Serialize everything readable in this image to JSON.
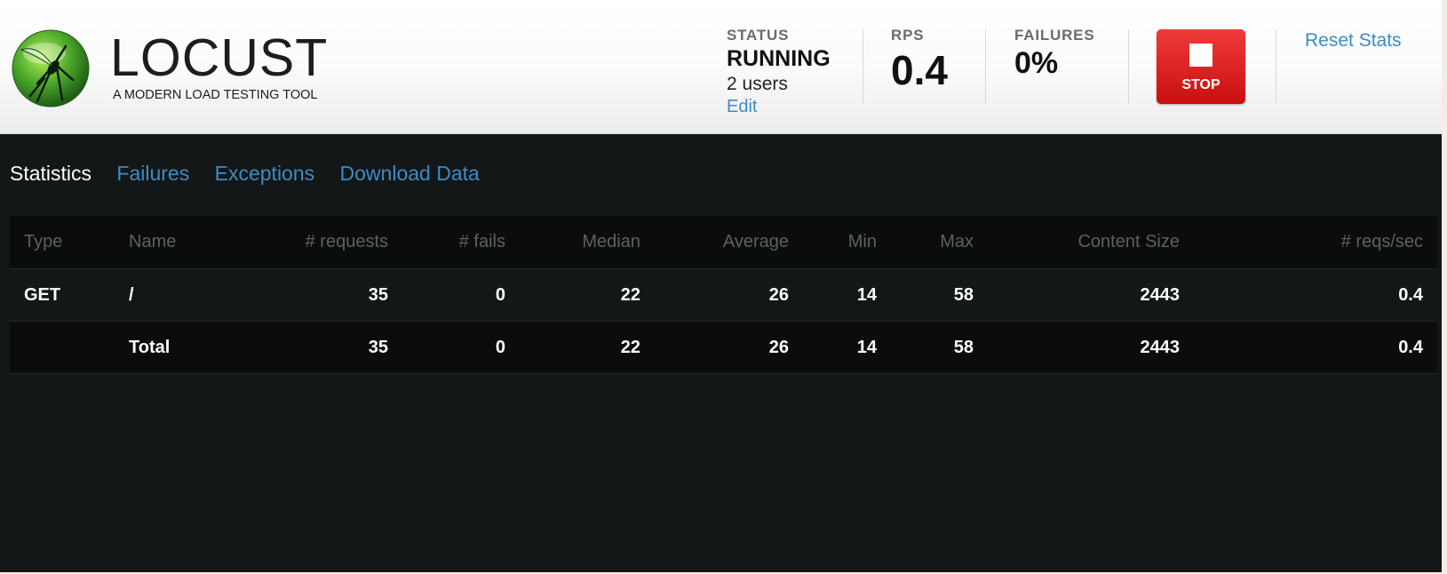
{
  "brand": {
    "name": "LOCUST",
    "tagline": "A MODERN LOAD TESTING TOOL"
  },
  "status": {
    "label": "STATUS",
    "value": "RUNNING",
    "users": "2 users",
    "edit_label": "Edit"
  },
  "rps": {
    "label": "RPS",
    "value": "0.4"
  },
  "failures": {
    "label": "FAILURES",
    "value": "0%"
  },
  "stop": {
    "label": "STOP"
  },
  "reset": {
    "label": "Reset Stats"
  },
  "tabs": [
    {
      "label": "Statistics",
      "active": true
    },
    {
      "label": "Failures",
      "active": false
    },
    {
      "label": "Exceptions",
      "active": false
    },
    {
      "label": "Download Data",
      "active": false
    }
  ],
  "table": {
    "headers": [
      "Type",
      "Name",
      "# requests",
      "# fails",
      "Median",
      "Average",
      "Min",
      "Max",
      "Content Size",
      "# reqs/sec"
    ],
    "rows": [
      [
        "GET",
        "/",
        "35",
        "0",
        "22",
        "26",
        "14",
        "58",
        "2443",
        "0.4"
      ],
      [
        "",
        "Total",
        "35",
        "0",
        "22",
        "26",
        "14",
        "58",
        "2443",
        "0.4"
      ]
    ]
  },
  "colors": {
    "accent": "#3a8cc6",
    "stop": "#e02020",
    "background": "#131717"
  }
}
